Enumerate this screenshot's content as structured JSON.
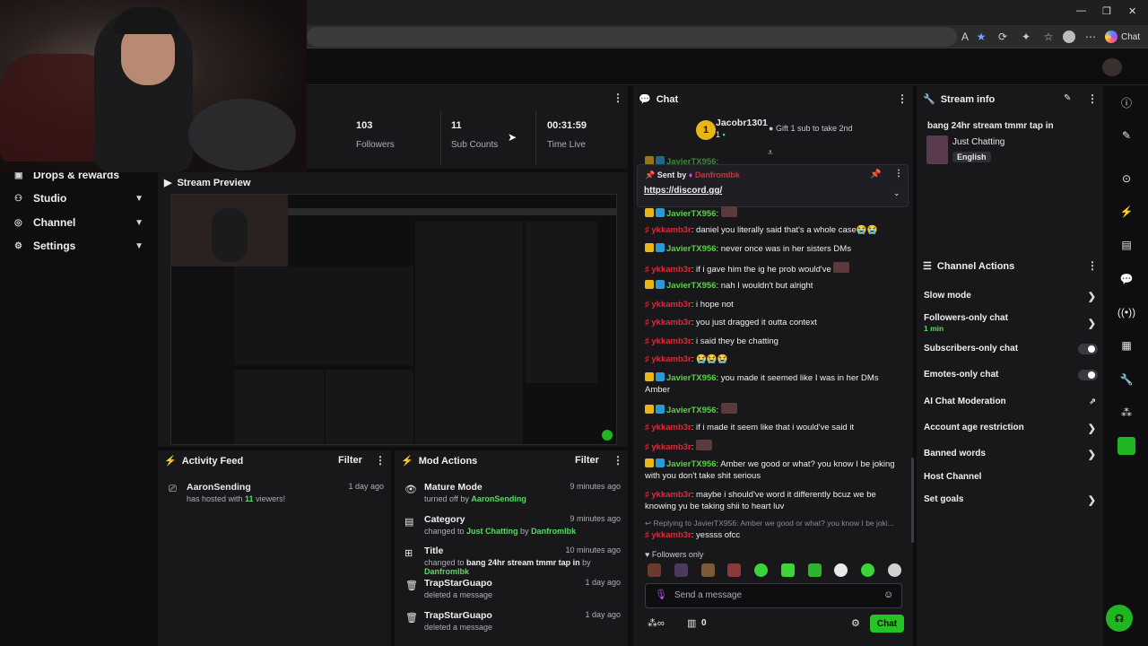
{
  "browser": {
    "copilot_label": "Chat"
  },
  "nav": {
    "items": [
      {
        "label": "Drops & rewards"
      },
      {
        "label": "Studio"
      },
      {
        "label": "Channel"
      },
      {
        "label": "Settings"
      }
    ]
  },
  "stats": {
    "followers": {
      "value": "103",
      "label": "Followers"
    },
    "subs": {
      "value": "11",
      "label": "Sub Counts"
    },
    "time": {
      "value": "00:31:59",
      "label": "Time Live"
    }
  },
  "preview": {
    "title": "Stream Preview"
  },
  "activity": {
    "title": "Activity Feed",
    "filter": "Filter",
    "items": [
      {
        "user": "AaronSending",
        "pre": "has hosted with ",
        "count": "11",
        "post": " viewers!",
        "time": "1 day ago"
      }
    ]
  },
  "mod": {
    "title": "Mod Actions",
    "filter": "Filter",
    "items": [
      {
        "title": "Mature Mode",
        "sub_pre": "turned off by ",
        "sub_user": "AaronSending",
        "time": "9 minutes ago"
      },
      {
        "title": "Category",
        "sub_pre": "changed to ",
        "sub_hl": "Just Chatting",
        "sub_mid": " by ",
        "sub_user": "Danfromlbk",
        "time": "9 minutes ago"
      },
      {
        "title": "Title",
        "sub_pre": "changed to ",
        "sub_bold": "bang 24hr stream tmmr tap in",
        "sub_mid": " by ",
        "sub_user": "Danfromlbk",
        "time": "10 minutes ago"
      },
      {
        "title": "TrapStarGuapo",
        "sub_pre": "deleted a message",
        "time": "1 day ago"
      },
      {
        "title": "TrapStarGuapo",
        "sub_pre": "deleted a message",
        "time": "1 day ago"
      }
    ]
  },
  "chat": {
    "title": "Chat",
    "top_gifter": {
      "rank": "1",
      "name": "Jacobr1301",
      "count": "1",
      "gift_text": "Gift 1 sub to take 2nd"
    },
    "pinned": {
      "sent_by": "Sent by",
      "user": "Danfromlbk",
      "link": "https://discord.gg/"
    },
    "messages": [
      {
        "user": "JavierTX956",
        "text": "",
        "color": "green"
      },
      {
        "user": "ykkamb3r",
        "text": "daniel you literally said that's a whole case😭😭",
        "color": "red"
      },
      {
        "user": "JavierTX956",
        "text": "never once was in her sisters DMs",
        "color": "green"
      },
      {
        "user": "ykkamb3r",
        "text": "if i gave him the ig he prob would've",
        "color": "red"
      },
      {
        "user": "JavierTX956",
        "text": "nah I wouldn't but alright",
        "color": "green"
      },
      {
        "user": "ykkamb3r",
        "text": "i hope not",
        "color": "red"
      },
      {
        "user": "ykkamb3r",
        "text": "you just dragged it outta context",
        "color": "red"
      },
      {
        "user": "ykkamb3r",
        "text": "i said they be chatting",
        "color": "red"
      },
      {
        "user": "ykkamb3r",
        "text": "😭😭😭",
        "color": "red"
      },
      {
        "user": "JavierTX956",
        "text": "you made it seemed like I was in her DMs Amber",
        "color": "green"
      },
      {
        "user": "JavierTX956",
        "text": "",
        "color": "green"
      },
      {
        "user": "ykkamb3r",
        "text": "if i made it seem like that i would've said it",
        "color": "red"
      },
      {
        "user": "ykkamb3r",
        "text": "",
        "color": "red"
      },
      {
        "user": "JavierTX956",
        "text": "Amber we good or what? you know I be joking with you don't take shit serious",
        "color": "green"
      },
      {
        "user": "ykkamb3r",
        "text": "maybe i should've word it differently bcuz we be knowing yu be taking shii to heart luv",
        "color": "red"
      },
      {
        "user": "ykkamb3r",
        "text": "yessss ofcc",
        "color": "red"
      }
    ],
    "reply_to": "Replying to JavierTX956: Amber we good or what? you know I be joki...",
    "followers_only": "Followers only",
    "input_placeholder": "Send a message",
    "points": "0",
    "send_label": "Chat"
  },
  "stream_info": {
    "title": "Stream info",
    "stream_title": "bang 24hr stream tmmr tap in",
    "category": "Just Chatting",
    "language": "English"
  },
  "channel_actions": {
    "title": "Channel Actions",
    "items": [
      {
        "label": "Slow mode",
        "kind": "arrow"
      },
      {
        "label": "Followers-only chat",
        "sub": "1 min",
        "kind": "arrow"
      },
      {
        "label": "Subscribers-only chat",
        "kind": "toggle"
      },
      {
        "label": "Emotes-only chat",
        "kind": "toggle"
      },
      {
        "label": "AI Chat Moderation",
        "kind": "external"
      },
      {
        "label": "Account age restriction",
        "kind": "arrow"
      },
      {
        "label": "Banned words",
        "kind": "arrow"
      },
      {
        "label": "Host Channel",
        "kind": "none"
      },
      {
        "label": "Set goals",
        "kind": "arrow"
      }
    ]
  },
  "colors": {
    "accent": "#53fc18",
    "username_red": "#d92c3a",
    "username_green": "#57d148"
  }
}
